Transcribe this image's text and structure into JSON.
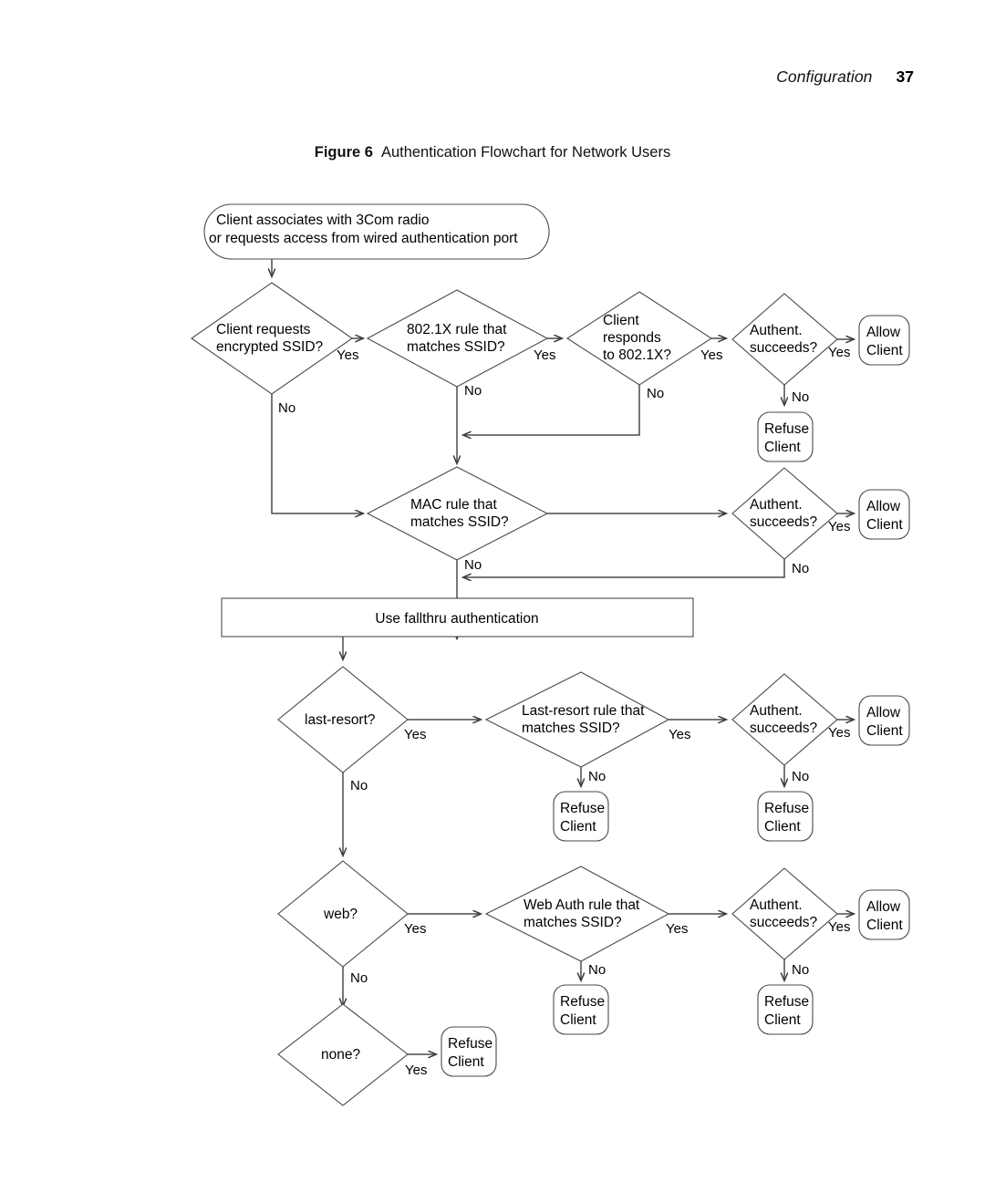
{
  "page": {
    "running_head": {
      "chapter": "Configuration",
      "page_number": "37"
    },
    "figure": {
      "label": "Figure 6",
      "title": "Authentication Flowchart for Network Users"
    }
  },
  "colors": {
    "shape_stroke": "#4a4a4a",
    "connector_stroke": "#4a4a4a",
    "text": "#000000",
    "background": "#ffffff"
  },
  "flowchart": {
    "type": "flowchart",
    "nodes": {
      "start": {
        "shape": "terminator",
        "line1": "Client associates with 3Com radio",
        "line2": "or requests access from wired authentication port"
      },
      "d_encrypted": {
        "shape": "decision",
        "line1": "Client requests",
        "line2": "encrypted SSID?"
      },
      "d_8021x_rule": {
        "shape": "decision",
        "line1": "802.1X rule that",
        "line2": "matches SSID?"
      },
      "d_client_responds": {
        "shape": "decision",
        "line1": "Client",
        "line2": "responds",
        "line3": "to 802.1X?"
      },
      "d_auth1": {
        "shape": "decision",
        "line1": "Authent.",
        "line2": "succeeds?"
      },
      "t_allow1": {
        "shape": "terminator",
        "line1": "Allow",
        "line2": "Client"
      },
      "t_refuse1": {
        "shape": "terminator",
        "line1": "Refuse",
        "line2": "Client"
      },
      "d_mac_rule": {
        "shape": "decision",
        "line1": "MAC rule that",
        "line2": "matches SSID?"
      },
      "d_auth2": {
        "shape": "decision",
        "line1": "Authent.",
        "line2": "succeeds?"
      },
      "t_allow2": {
        "shape": "terminator",
        "line1": "Allow",
        "line2": "Client"
      },
      "p_fallthru": {
        "shape": "process",
        "line1": "Use fallthru authentication"
      },
      "d_last_resort": {
        "shape": "decision",
        "line1": "last-resort?"
      },
      "d_last_resort_rule": {
        "shape": "decision",
        "line1": "Last-resort rule that",
        "line2": "matches SSID?"
      },
      "t_refuse_lr_rule": {
        "shape": "terminator",
        "line1": "Refuse",
        "line2": "Client"
      },
      "d_auth3": {
        "shape": "decision",
        "line1": "Authent.",
        "line2": "succeeds?"
      },
      "t_allow3": {
        "shape": "terminator",
        "line1": "Allow",
        "line2": "Client"
      },
      "t_refuse3": {
        "shape": "terminator",
        "line1": "Refuse",
        "line2": "Client"
      },
      "d_web": {
        "shape": "decision",
        "line1": "web?"
      },
      "d_web_rule": {
        "shape": "decision",
        "line1": "Web Auth rule that",
        "line2": "matches SSID?"
      },
      "t_refuse_web_rule": {
        "shape": "terminator",
        "line1": "Refuse",
        "line2": "Client"
      },
      "d_auth4": {
        "shape": "decision",
        "line1": "Authent.",
        "line2": "succeeds?"
      },
      "t_allow4": {
        "shape": "terminator",
        "line1": "Allow",
        "line2": "Client"
      },
      "t_refuse4": {
        "shape": "terminator",
        "line1": "Refuse",
        "line2": "Client"
      },
      "d_none": {
        "shape": "decision",
        "line1": "none?"
      },
      "t_refuse_none": {
        "shape": "terminator",
        "line1": "Refuse",
        "line2": "Client"
      }
    },
    "edge_labels": {
      "encrypted_yes": "Yes",
      "encrypted_no": "No",
      "rule8021x_yes": "Yes",
      "rule8021x_no": "No",
      "responds_yes": "Yes",
      "responds_no": "No",
      "auth1_yes": "Yes",
      "auth1_no": "No",
      "mac_no": "No",
      "auth2_yes": "Yes",
      "auth2_no": "No",
      "lastresort_yes": "Yes",
      "lastresort_no": "No",
      "lrrule_yes": "Yes",
      "lrrule_no": "No",
      "auth3_yes": "Yes",
      "auth3_no": "No",
      "web_yes": "Yes",
      "web_no": "No",
      "webrule_yes": "Yes",
      "webrule_no": "No",
      "auth4_yes": "Yes",
      "auth4_no": "No",
      "none_yes": "Yes"
    }
  }
}
